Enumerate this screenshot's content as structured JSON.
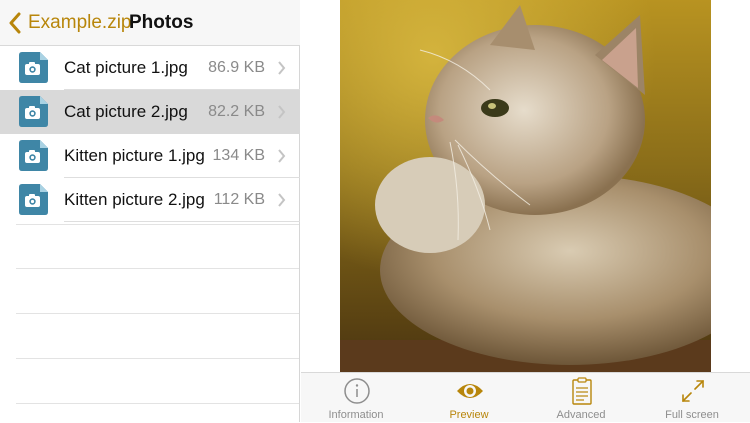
{
  "navbar": {
    "back_label": "Example.zip",
    "title": "Photos"
  },
  "files": [
    {
      "name": "Cat picture 1.jpg",
      "size": "86.9 KB",
      "selected": false
    },
    {
      "name": "Cat picture 2.jpg",
      "size": "82.2 KB",
      "selected": true
    },
    {
      "name": "Kitten picture 1.jpg",
      "size": "134 KB",
      "selected": false
    },
    {
      "name": "Kitten picture 2.jpg",
      "size": "112 KB",
      "selected": false
    }
  ],
  "icons": {
    "file": "camera-file-icon",
    "back": "chevron-left-icon",
    "disclosure": "chevron-right-icon"
  },
  "tabs": [
    {
      "label": "Information",
      "icon": "info-icon",
      "active": false
    },
    {
      "label": "Preview",
      "icon": "eye-icon",
      "active": true
    },
    {
      "label": "Advanced",
      "icon": "clipboard-icon",
      "active": false
    },
    {
      "label": "Full screen",
      "icon": "expand-icon",
      "active": false
    }
  ],
  "colors": {
    "accent": "#b8860b",
    "selected_row": "#d9d9d9",
    "file_icon": "#3f86a6"
  }
}
